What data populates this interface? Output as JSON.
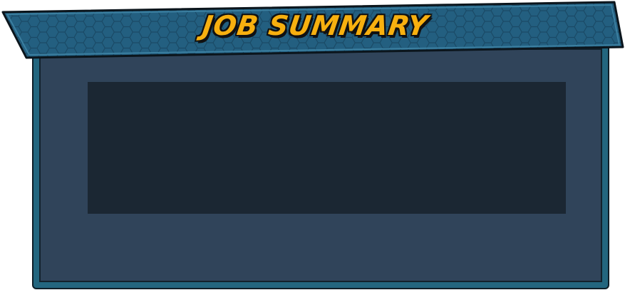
{
  "header": {
    "title": "JOB SUMMARY"
  },
  "colors": {
    "title_text": "#f7b00f",
    "banner_fill": "#235f80",
    "panel_border": "#23667f",
    "panel_fill": "#30445a",
    "content_well": "#1b2733"
  }
}
